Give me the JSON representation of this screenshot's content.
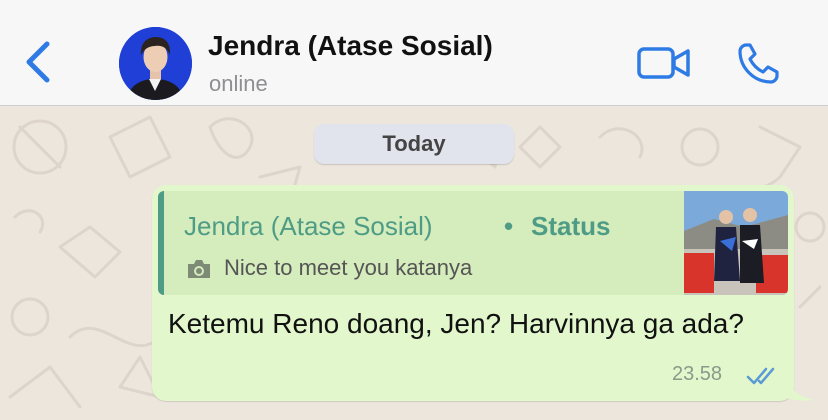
{
  "header": {
    "back_icon": "chevron-left-icon",
    "contact_name": "Jendra (Atase Sosial)",
    "presence": "online",
    "video_icon": "video-camera-icon",
    "call_icon": "phone-icon",
    "accent_color": "#2f7be5"
  },
  "chat": {
    "date_label": "Today",
    "message": {
      "quote": {
        "name": "Jendra (Atase Sosial)",
        "separator": "•",
        "tag": "Status",
        "camera_icon": "camera-icon",
        "text": "Nice to meet you katanya"
      },
      "text": "Ketemu Reno doang, Jen? Harvinnya ga ada?",
      "time": "23.58",
      "receipt_icon": "double-check-icon",
      "bubble_color": "#e2f7cb",
      "receipt_color": "#5b9bd5"
    }
  }
}
